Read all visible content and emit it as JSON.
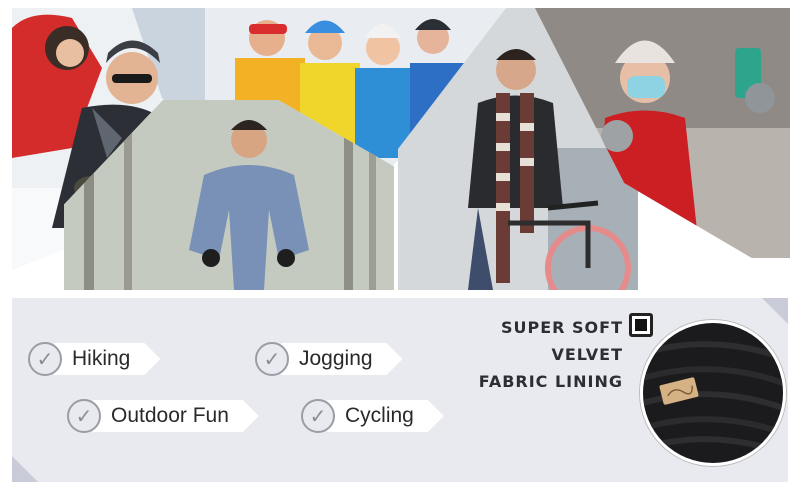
{
  "activities": [
    {
      "label": "Hiking"
    },
    {
      "label": "Jogging"
    },
    {
      "label": "Outdoor Fun"
    },
    {
      "label": "Cycling"
    }
  ],
  "feature_lines": [
    "SUPER SOFT",
    "VELVET",
    "FABRIC LINING"
  ],
  "icons": {
    "check": "check-circle-icon",
    "feature_mark": "black-square-icon"
  },
  "colors": {
    "panel_bg": "#e9eaf0",
    "tag_bg": "#ffffff",
    "check_color": "#8a8c96",
    "text_dark": "#2d2d36",
    "fabric": "#1b1b1d"
  }
}
